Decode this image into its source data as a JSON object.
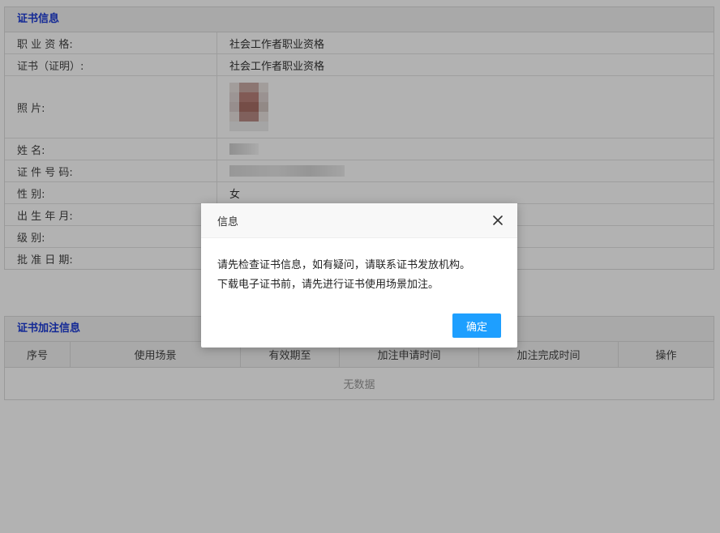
{
  "cert_section": {
    "title": "证书信息",
    "rows": [
      {
        "label": "职 业 资 格:",
        "value": "社会工作者职业资格"
      },
      {
        "label": "证书（证明）:",
        "value": "社会工作者职业资格"
      },
      {
        "label": "照        片:",
        "value": ""
      },
      {
        "label": "姓        名:",
        "value": ""
      },
      {
        "label": "证 件 号 码:",
        "value": ""
      },
      {
        "label": "性        别:",
        "value": "女"
      },
      {
        "label": "出 生 年 月:",
        "value": ""
      },
      {
        "label": "级        别:",
        "value": ""
      },
      {
        "label": "批 准 日 期:",
        "value": ""
      }
    ]
  },
  "endorse_section": {
    "title": "证书加注信息",
    "columns": [
      "序号",
      "使用场景",
      "有效期至",
      "加注申请时间",
      "加注完成时间",
      "操作"
    ],
    "empty_text": "无数据"
  },
  "dialog": {
    "title": "信息",
    "line1": "请先检查证书信息，如有疑问，请联系证书发放机构。",
    "line2": "下载电子证书前，请先进行证书使用场景加注。",
    "ok_label": "确定"
  },
  "colors": {
    "section_title": "#1a3ad6",
    "primary_button": "#1e9fff",
    "overlay": "rgba(0,0,0,0.3)"
  },
  "icons": {
    "close": "close-icon"
  }
}
